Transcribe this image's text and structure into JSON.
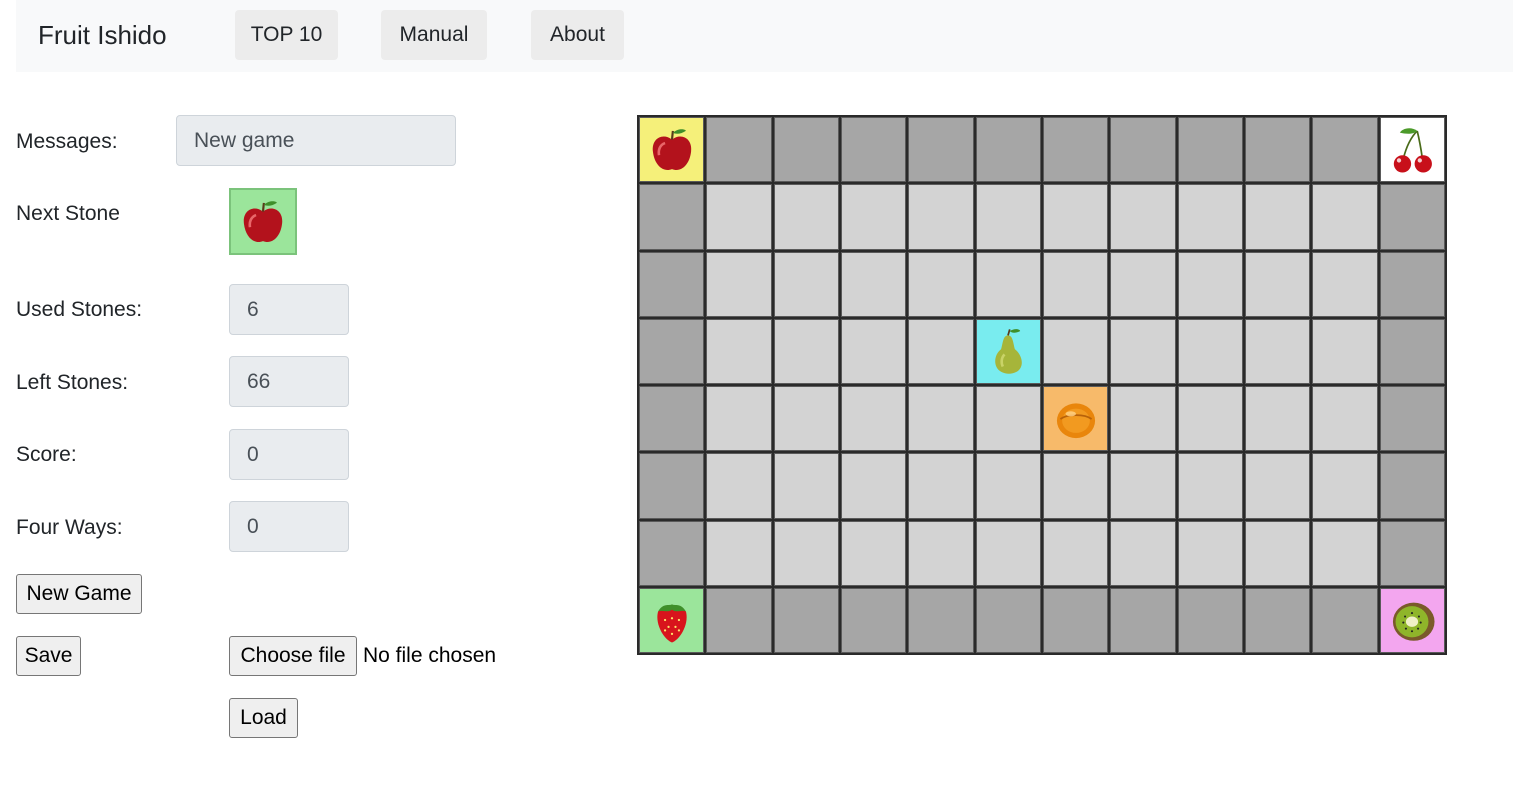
{
  "nav": {
    "brand": "Fruit Ishido",
    "items": [
      "TOP 10",
      "Manual",
      "About"
    ]
  },
  "panel": {
    "messages_label": "Messages:",
    "messages_value": "New game",
    "next_stone_label": "Next Stone",
    "next_stone": {
      "fruit": "apple-icon",
      "color": "#9be59b"
    },
    "used_label": "Used Stones:",
    "used_value": "6",
    "left_label": "Left Stones:",
    "left_value": "66",
    "score_label": "Score:",
    "score_value": "0",
    "fourways_label": "Four Ways:",
    "fourways_value": "0",
    "new_game_button": "New Game",
    "save_button": "Save",
    "choose_file_button": "Choose file",
    "file_status": "No file chosen",
    "load_button": "Load"
  },
  "board": {
    "rows": 8,
    "cols": 12,
    "empty_inner_color": "#d3d3d3",
    "empty_edge_color": "#a6a6a6",
    "stones": [
      {
        "row": 0,
        "col": 0,
        "fruit": "apple",
        "bg": "#f5f07a"
      },
      {
        "row": 0,
        "col": 11,
        "fruit": "cherry",
        "bg": "#ffffff"
      },
      {
        "row": 3,
        "col": 5,
        "fruit": "pear",
        "bg": "#79ecef"
      },
      {
        "row": 4,
        "col": 6,
        "fruit": "orange",
        "bg": "#f7ba6a"
      },
      {
        "row": 7,
        "col": 0,
        "fruit": "strawberry",
        "bg": "#9be59b"
      },
      {
        "row": 7,
        "col": 11,
        "fruit": "kiwi",
        "bg": "#f3a6ef"
      }
    ]
  }
}
